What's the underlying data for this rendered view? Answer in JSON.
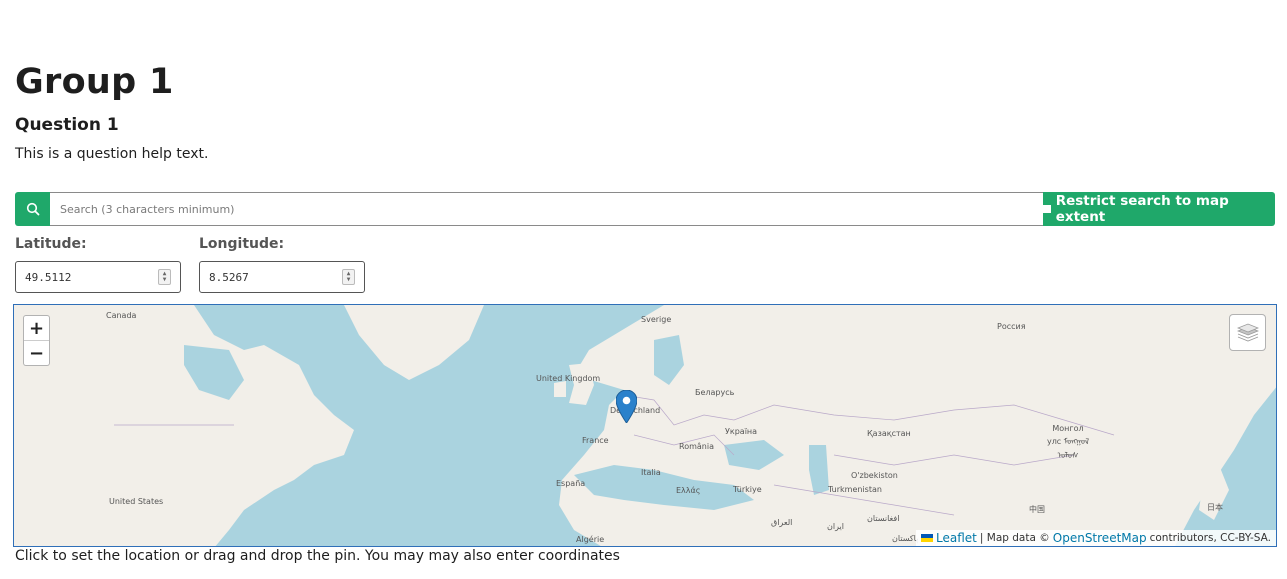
{
  "group_title": "Group 1",
  "question": {
    "title": "Question 1",
    "help": "This is a question help text."
  },
  "search": {
    "placeholder": "Search (3 characters minimum)",
    "value": "",
    "restrict_label": "Restrict search to map extent"
  },
  "coordinates": {
    "latitude_label": "Latitude:",
    "latitude_value": "49.5112",
    "longitude_label": "Longitude:",
    "longitude_value": "8.5267"
  },
  "map": {
    "zoom_in": "+",
    "zoom_out": "−",
    "labels": [
      "Canada",
      "Sverige",
      "Россия",
      "United Kingdom",
      "Беларусь",
      "Deutschland",
      "Україна",
      "France",
      "România",
      "Қазақстан",
      "Монгол улс ᠮᠣᠩᠭᠣᠯ ᠤᠯᠤᠰ",
      "Italia",
      "O'zbekiston",
      "España",
      "Ελλάς",
      "Türkiye",
      "Turkmenistan",
      "United States",
      "中国",
      "Algérie",
      "العراق",
      "ایران",
      "افغانستان",
      "日本",
      "پاکستان"
    ],
    "attribution": {
      "leaflet": "Leaflet",
      "separator": "| Map data ©",
      "osm": "OpenStreetMap",
      "rest": "contributors, CC-BY-SA."
    },
    "colors": {
      "water": "#aad3df",
      "land": "#f2efe9",
      "border": "#b9a8c9",
      "pin": "#2a81cb"
    }
  },
  "footer": "Click to set the location or drag and drop the pin. You may may also enter coordinates"
}
